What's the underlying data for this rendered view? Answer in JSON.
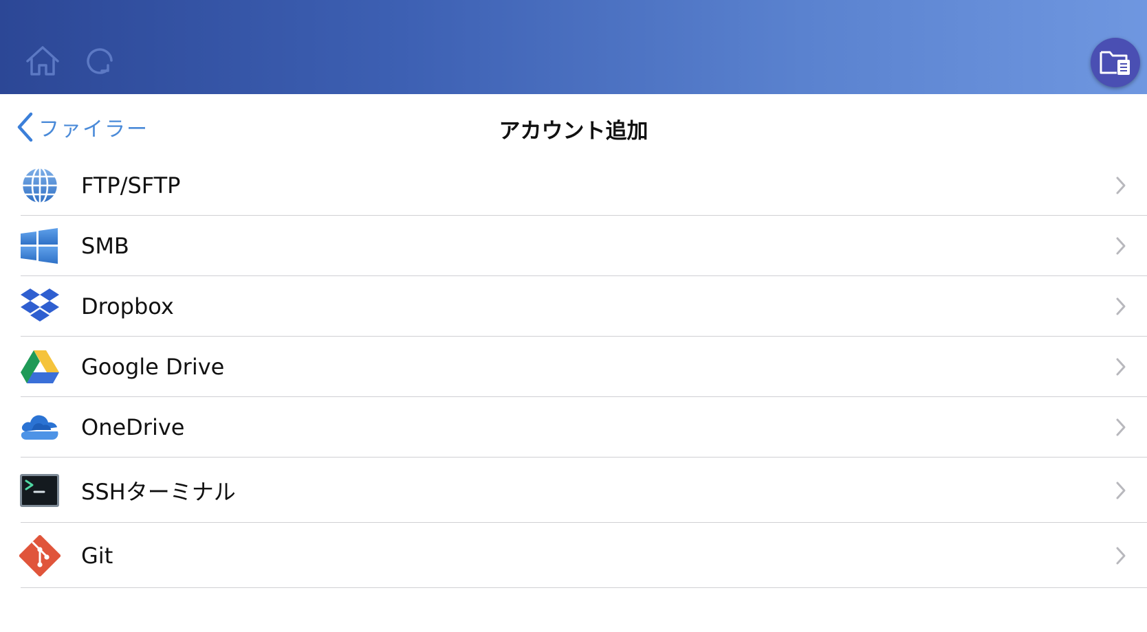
{
  "header": {
    "home_icon": "home-icon",
    "refresh_icon": "refresh-icon",
    "files_icon": "folder-document-icon",
    "gradient_colors": [
      "#2c4796",
      "#6f97e0"
    ]
  },
  "nav": {
    "back_label": "ファイラー",
    "title": "アカウント追加"
  },
  "accounts": [
    {
      "label": "FTP/SFTP",
      "icon": "globe-icon"
    },
    {
      "label": "SMB",
      "icon": "windows-icon"
    },
    {
      "label": "Dropbox",
      "icon": "dropbox-icon"
    },
    {
      "label": "Google Drive",
      "icon": "google-drive-icon"
    },
    {
      "label": "OneDrive",
      "icon": "onedrive-icon"
    },
    {
      "label": "SSHターミナル",
      "icon": "terminal-icon"
    },
    {
      "label": "Git",
      "icon": "git-icon"
    }
  ]
}
